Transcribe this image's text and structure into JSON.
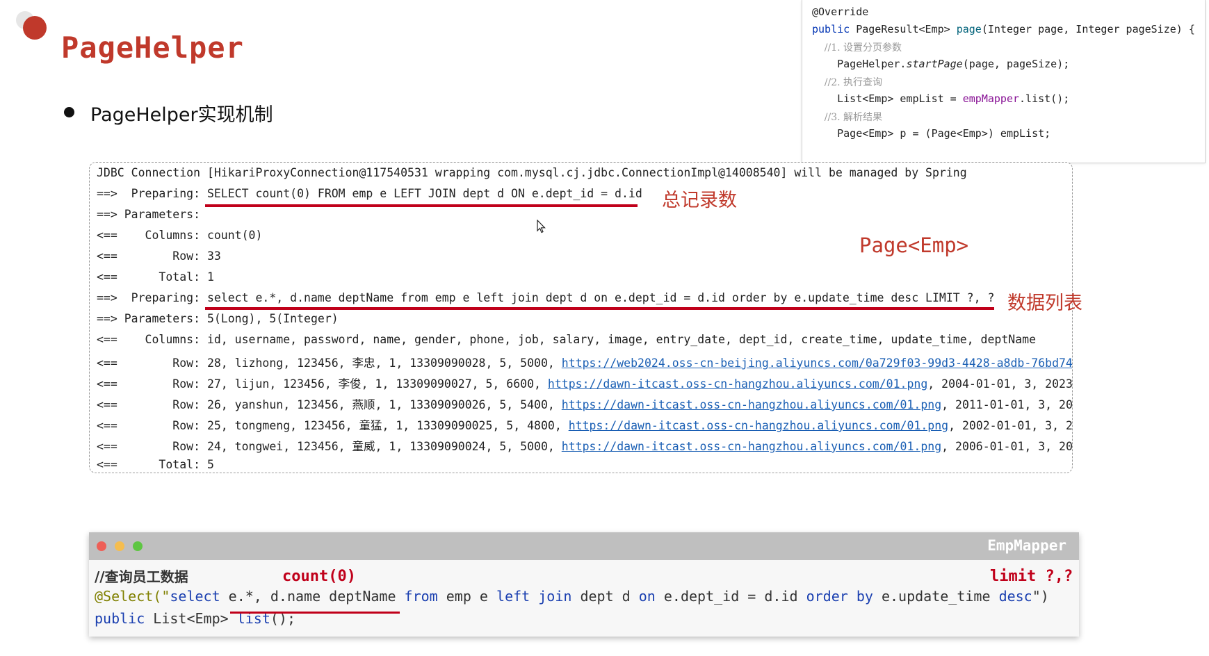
{
  "slide": {
    "title": "PageHelper",
    "bullet": "PageHelper实现机制"
  },
  "snippet": {
    "lines": [
      "@Override",
      "public PageResult<Emp> page(Integer page, Integer pageSize) {",
      "    //1. 设置分页参数",
      "    PageHelper.startPage(page, pageSize);",
      "    //2. 执行查询",
      "    List<Emp> empList = empMapper.list();",
      "    //3. 解析结果",
      "    Page<Emp> p = (Page<Emp>) empList;"
    ]
  },
  "log": {
    "header": "JDBC Connection [HikariProxyConnection@117540531 wrapping com.mysql.cj.jdbc.ConnectionImpl@14008540] will be managed by Spring",
    "lines": [
      "==>  Preparing: SELECT count(0) FROM emp e LEFT JOIN dept d ON e.dept_id = d.id",
      "==> Parameters: ",
      "<==    Columns: count(0)",
      "<==        Row: 33",
      "<==      Total: 1",
      "==>  Preparing: select e.*, d.name deptName from emp e left join dept d on e.dept_id = d.id order by e.update_time desc LIMIT ?, ?",
      "==> Parameters: 5(Long), 5(Integer)",
      "<==    Columns: id, username, password, name, gender, phone, job, salary, image, entry_date, dept_id, create_time, update_time, deptName"
    ],
    "rows": [
      {
        "prefix": "<==        Row: 28, lizhong, 123456, 李忠, 1, 13309090028, 5, 5000, ",
        "link": "https://web2024.oss-cn-beijing.aliyuncs.com/0a729f03-99d3-4428-a8db-76bd742",
        "suffix": ""
      },
      {
        "prefix": "<==        Row: 27, lijun, 123456, 李俊, 1, 13309090027, 5, 6600, ",
        "link": "https://dawn-itcast.oss-cn-hangzhou.aliyuncs.com/01.png",
        "suffix": ", 2004-01-01, 3, 2023-"
      },
      {
        "prefix": "<==        Row: 26, yanshun, 123456, 燕顺, 1, 13309090026, 5, 5400, ",
        "link": "https://dawn-itcast.oss-cn-hangzhou.aliyuncs.com/01.png",
        "suffix": ", 2011-01-01, 3, 202"
      },
      {
        "prefix": "<==        Row: 25, tongmeng, 123456, 童猛, 1, 13309090025, 5, 4800, ",
        "link": "https://dawn-itcast.oss-cn-hangzhou.aliyuncs.com/01.png",
        "suffix": ", 2002-01-01, 3, 20"
      },
      {
        "prefix": "<==        Row: 24, tongwei, 123456, 童威, 1, 13309090024, 5, 5000, ",
        "link": "https://dawn-itcast.oss-cn-hangzhou.aliyuncs.com/01.png",
        "suffix": ", 2006-01-01, 3, 202"
      }
    ],
    "total": "<==      Total: 5"
  },
  "annotations": {
    "count_label": "总记录数",
    "page_type": "Page<Emp>",
    "list_label": "数据列表"
  },
  "mapper": {
    "window_title": "EmpMapper",
    "comment": "//查询员工数据",
    "count_note": "count(0)",
    "limit_note": "limit ?,?",
    "annotation": "@Select(\"",
    "select_kw": "select",
    "select_cols": "e.*, d.name deptName",
    "from_kw": "from",
    "table1": "emp e",
    "join_kw": "left join",
    "table2": "dept d",
    "on_kw": "on",
    "cond": "e.dept_id = d.id",
    "order_kw": "order by",
    "order_col": "e.update_time",
    "desc_kw": "desc",
    "close": "\")",
    "method_line": "public List<Emp> list();"
  },
  "colors": {
    "accent_red": "#c0392b",
    "link_blue": "#1a5fb4"
  }
}
